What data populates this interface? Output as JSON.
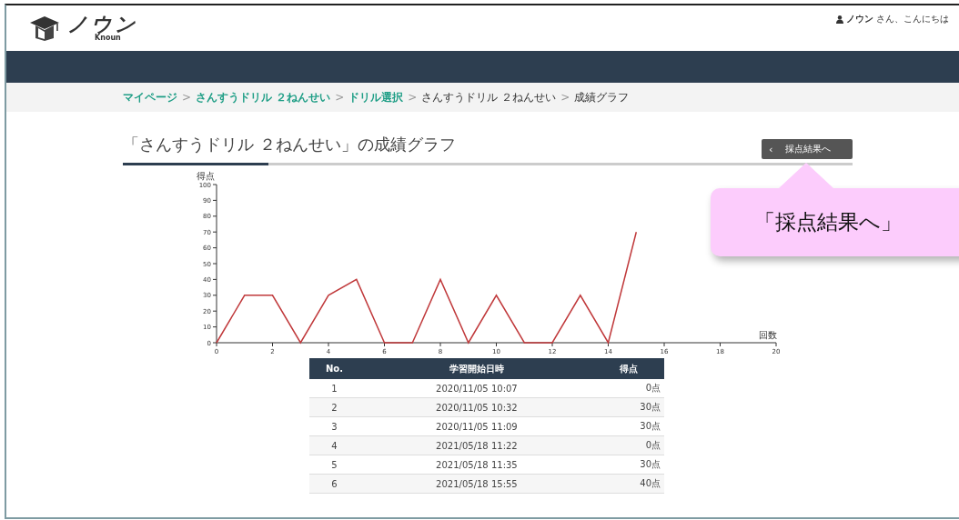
{
  "header": {
    "logo_text": "ノウン",
    "logo_subtext": "Knoun",
    "greeting_name": "ノウン",
    "greeting_suffix": "さん、こんにちは"
  },
  "breadcrumb": [
    {
      "label": "マイページ",
      "link": true
    },
    {
      "label": "さんすうドリル ２ねんせい",
      "link": true
    },
    {
      "label": "ドリル選択",
      "link": true
    },
    {
      "label": "さんすうドリル ２ねんせい",
      "link": false
    },
    {
      "label": "成績グラフ",
      "link": false
    }
  ],
  "breadcrumb_separator": ">",
  "page_title": "「さんすうドリル ２ねんせい」の成績グラフ",
  "back_button": {
    "icon": "‹",
    "label": "採点結果へ"
  },
  "callout": {
    "text": "「採点結果へ」"
  },
  "chart": {
    "chart_data": {
      "type": "line",
      "xlabel": "回数",
      "ylabel": "得点",
      "x": [
        0,
        1,
        2,
        3,
        4,
        5,
        6,
        7,
        8,
        9,
        10,
        11,
        12,
        13,
        14,
        15
      ],
      "series": [
        {
          "color": "#c0393b",
          "values": [
            0,
            30,
            30,
            0,
            30,
            40,
            0,
            0,
            40,
            0,
            30,
            0,
            0,
            30,
            0,
            70
          ]
        }
      ],
      "xlim": [
        0,
        20
      ],
      "ylim": [
        0,
        100
      ],
      "xticks": [
        0,
        2,
        4,
        6,
        8,
        10,
        12,
        14,
        16,
        18,
        20
      ],
      "yticks": [
        0,
        10,
        20,
        30,
        40,
        50,
        60,
        70,
        80,
        90,
        100
      ]
    }
  },
  "table": {
    "columns": [
      "No.",
      "学習開始日時",
      "得点"
    ],
    "rows": [
      [
        "1",
        "2020/11/05 10:07",
        "0点"
      ],
      [
        "2",
        "2020/11/05 10:32",
        "30点"
      ],
      [
        "3",
        "2020/11/05 11:09",
        "30点"
      ],
      [
        "4",
        "2021/05/18 11:22",
        "0点"
      ],
      [
        "5",
        "2021/05/18 11:35",
        "30点"
      ],
      [
        "6",
        "2021/05/18 15:55",
        "40点"
      ]
    ]
  }
}
